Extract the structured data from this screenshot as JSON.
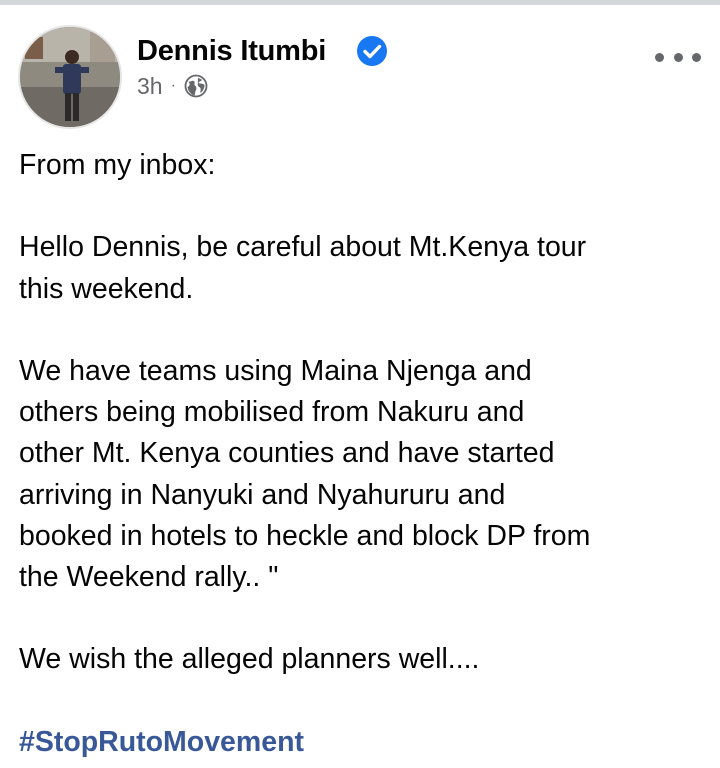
{
  "post": {
    "author": "Dennis Itumbi",
    "time": "3h",
    "separator": "·",
    "privacy_icon": "globe-icon",
    "verified_icon": "verified-badge-icon",
    "more_icon": "more-options-icon",
    "colors": {
      "verified": "#1877f2",
      "hashtag": "#385898",
      "meta_text": "#65676b"
    },
    "body": {
      "p1": "From my inbox:",
      "p2": "Hello Dennis, be careful about Mt.Kenya tour\nthis weekend.",
      "p3": "We have teams using Maina Njenga and\nothers being mobilised from Nakuru and\nother Mt. Kenya counties and have started\narriving in Nanyuki and Nyahururu and\nbooked in hotels to heckle and block DP from\nthe Weekend rally.. \"",
      "p4": "We wish the alleged planners well....",
      "hashtag": "#StopRutoMovement"
    }
  }
}
